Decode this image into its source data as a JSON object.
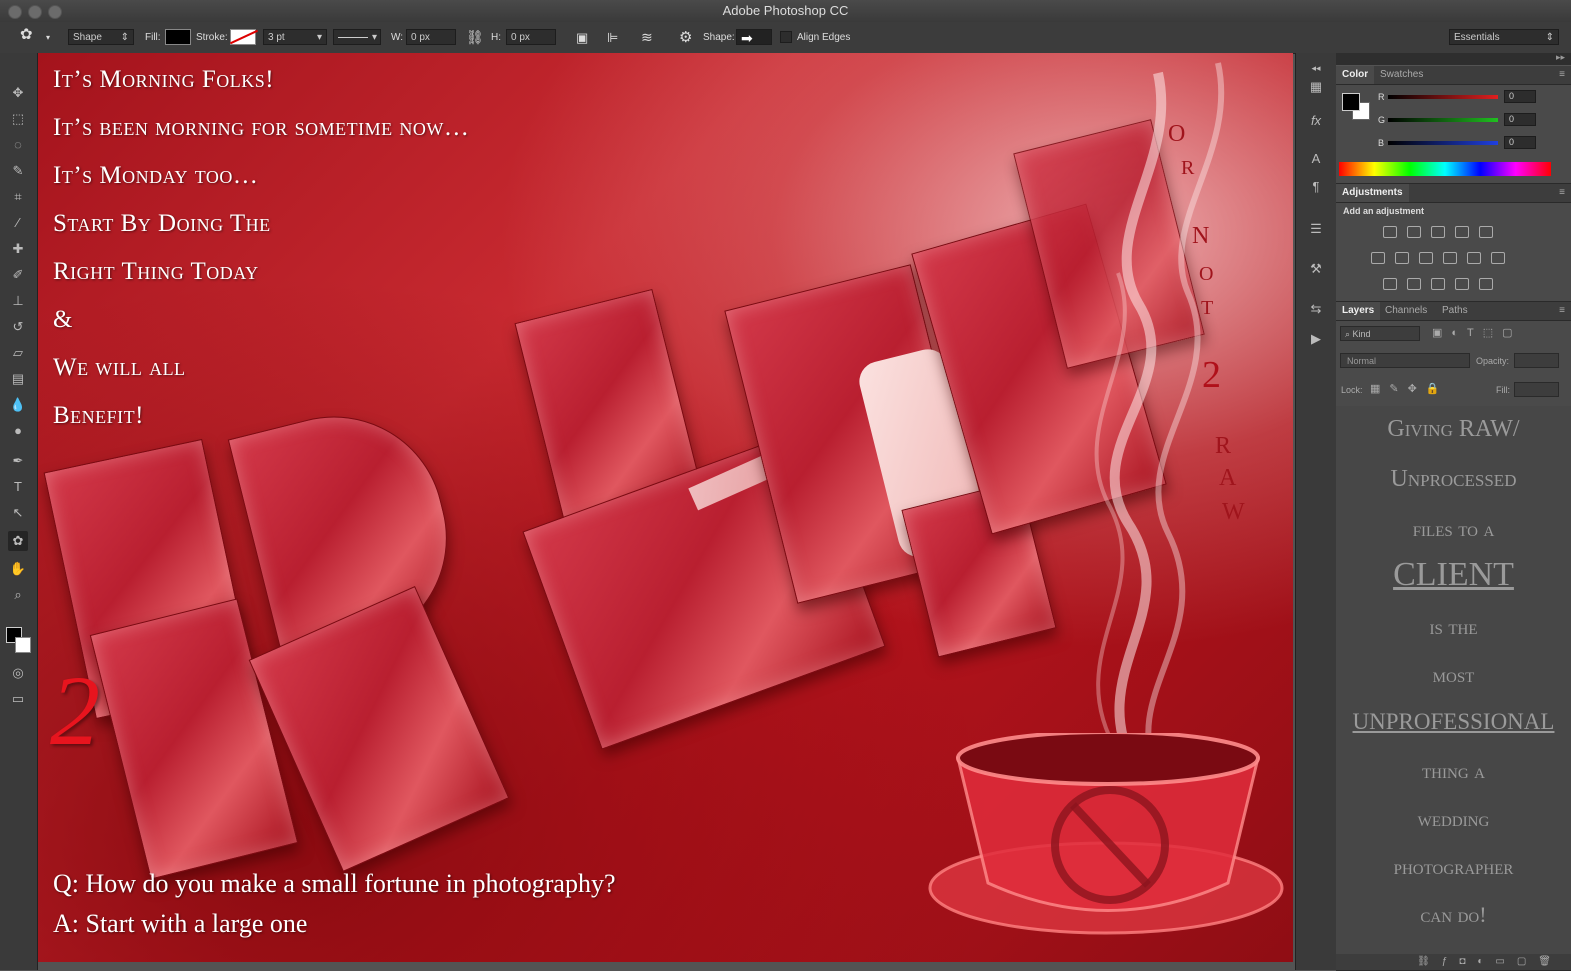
{
  "window": {
    "title": "Adobe Photoshop CC"
  },
  "options_bar": {
    "mode": "Shape",
    "fill_label": "Fill:",
    "stroke_label": "Stroke:",
    "stroke_width": "3 pt",
    "w_label": "W:",
    "w_value": "0 px",
    "h_label": "H:",
    "h_value": "0 px",
    "shape_label": "Shape:",
    "align_edges": "Align Edges",
    "workspace": "Essentials"
  },
  "canvas": {
    "lines": [
      "It’s Morning Folks!",
      "It’s been morning for sometime now…",
      "It’s Monday too…",
      "Start By Doing The",
      "Right Thing Today",
      "&",
      "We will all",
      "Benefit!"
    ],
    "big_two": "2",
    "q_line": "Q: How do you make a small fortune in photography?",
    "a_line": "A: Start with a large one",
    "vertical_letters": [
      "O",
      "R",
      "N",
      "O",
      "T",
      "2",
      "R",
      "A",
      "W"
    ]
  },
  "color_panel": {
    "tabs": [
      "Color",
      "Swatches"
    ],
    "channels": [
      {
        "label": "R",
        "value": "0",
        "color": "#e02020"
      },
      {
        "label": "G",
        "value": "0",
        "color": "#20c020"
      },
      {
        "label": "B",
        "value": "0",
        "color": "#2040e0"
      }
    ]
  },
  "adjustments_panel": {
    "tab": "Adjustments",
    "heading": "Add an adjustment"
  },
  "layers_panel": {
    "tabs": [
      "Layers",
      "Channels",
      "Paths"
    ],
    "kind": "Kind",
    "blend_mode": "Normal",
    "opacity_label": "Opacity:",
    "lock_label": "Lock:",
    "fill_label": "Fill:"
  },
  "gray_text": {
    "lines": [
      "Giving RAW/",
      "Unprocessed",
      "files to a",
      "CLIENT",
      "is the",
      "most",
      "UNPROFESSIONAL",
      "thing a",
      "wedding",
      "photographer",
      "can do!"
    ]
  }
}
